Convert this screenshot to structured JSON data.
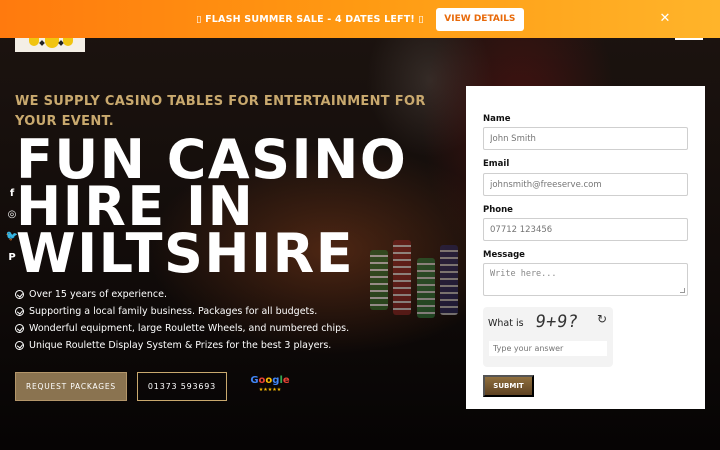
{
  "promo_bar": {
    "text": "▯ FLASH SUMMER SALE - 4 DATES LEFT! ▯",
    "button_label": "VIEW DETAILS",
    "close_glyph": "✕",
    "gradient_start": "#ff7a0e",
    "gradient_end": "#ffb42a"
  },
  "social": [
    {
      "icon": "facebook-icon",
      "glyph": "f"
    },
    {
      "icon": "instagram-icon",
      "glyph": "◎"
    },
    {
      "icon": "twitter-icon",
      "glyph": "🐦"
    },
    {
      "icon": "pinterest-icon",
      "glyph": "P"
    }
  ],
  "hero": {
    "tagline": "WE SUPPLY CASINO TABLES FOR ENTERTAINMENT FOR YOUR EVENT.",
    "headline_line1": "FUN CASINO",
    "headline_line2": "HIRE IN",
    "headline_line3": "WILTSHIRE",
    "features": [
      "Over 15 years of experience.",
      "Supporting a local family business. Packages for all budgets.",
      "Wonderful equipment, large Roulette Wheels, and numbered chips.",
      "Unique Roulette Display System & Prizes for the best 3 players."
    ],
    "cta_primary": "REQUEST PACKAGES",
    "cta_phone": "01373 593693",
    "google_badge": {
      "letters": [
        "G",
        "o",
        "o",
        "g",
        "l",
        "e"
      ],
      "stars": "★★★★★"
    },
    "accent_color": "#c9a96e"
  },
  "form": {
    "name_label": "Name",
    "name_placeholder": "John Smith",
    "email_label": "Email",
    "email_placeholder": "johnsmith@freeserve.com",
    "phone_label": "Phone",
    "phone_placeholder": "07712 123456",
    "message_label": "Message",
    "message_placeholder": "Write here...",
    "captcha_question": "What is",
    "captcha_image_text": "9+9?",
    "captcha_refresh_glyph": "↻",
    "captcha_answer_placeholder": "Type your answer",
    "submit_label": "SUBMIT"
  }
}
